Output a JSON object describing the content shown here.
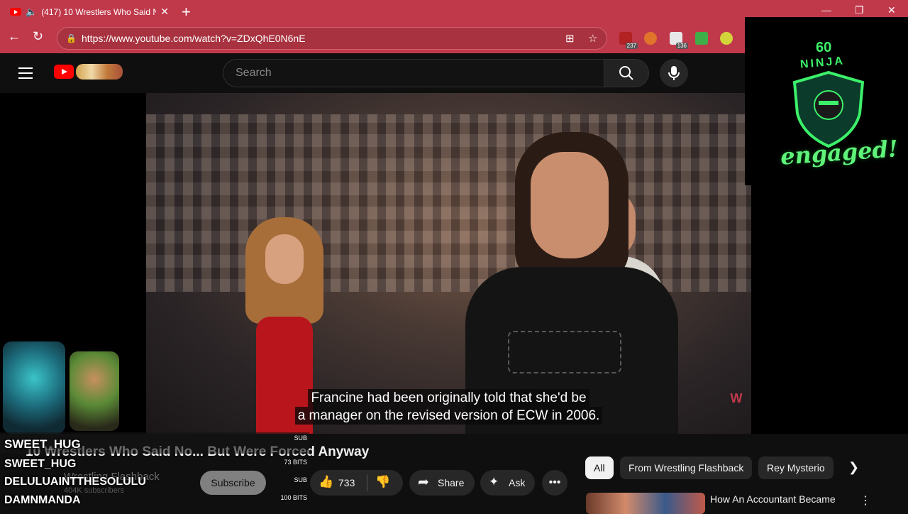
{
  "browser": {
    "tab_title": "(417) 10 Wrestlers Who Said N",
    "url": "https://www.youtube.com/watch?v=ZDxQhE0N6nE",
    "extension_badges": [
      "237",
      "136"
    ]
  },
  "youtube": {
    "search_placeholder": "Search",
    "captions": [
      "Francine had been originally told that she'd be",
      "a manager on the revised version of ECW in 2006."
    ],
    "video_title": "10 Wrestlers Who Said No... But Were Forced Anyway",
    "channel_name": "Wrestling Flashback",
    "subscriber_count": "404K subscribers",
    "subscribe_label": "Subscribe",
    "like_count": "733",
    "share_label": "Share",
    "ask_label": "Ask",
    "chips": [
      "All",
      "From Wrestling Flashback",
      "Rey Mysterio"
    ],
    "recommendation_title": "How An Accountant Became"
  },
  "overlay": {
    "badge_number": "60",
    "badge_word": "NINJA",
    "status": "engaged!"
  },
  "event_feed": [
    {
      "name": "SWEET_HUG",
      "tag": "SUB"
    },
    {
      "name": "SWEET_HUG",
      "tag": "73 BITS"
    },
    {
      "name": "DELULUAINTTHESOLULU",
      "tag": "SUB"
    },
    {
      "name": "DAMNMANDA",
      "tag": "100 BITS"
    }
  ]
}
